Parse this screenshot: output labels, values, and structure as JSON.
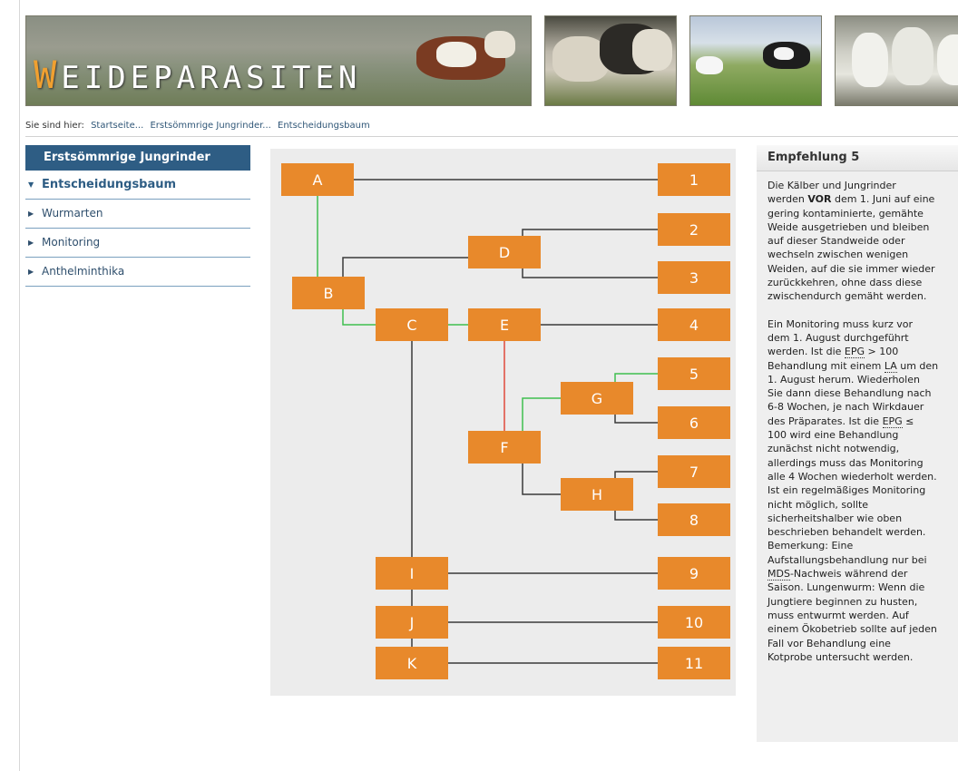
{
  "site": {
    "logo_initial": "W",
    "logo_rest": "EIDEPARASITEN",
    "images": [
      "Rind auf Weide",
      "Schafe",
      "Kühe mit Kalb",
      "Ziegen"
    ]
  },
  "breadcrumb": {
    "prefix": "Sie sind hier:",
    "items": [
      "Startseite...",
      "Erstsömmrige Jungrinder...",
      "Entscheidungsbaum"
    ]
  },
  "sidebar": {
    "title": "Erstsömmrige Jungrinder",
    "items": [
      {
        "label": "Entscheidungsbaum",
        "active": true,
        "caret": "▼"
      },
      {
        "label": "Wurmarten",
        "active": false,
        "caret": "▶"
      },
      {
        "label": "Monitoring",
        "active": false,
        "caret": "▶"
      },
      {
        "label": "Anthelminthika",
        "active": false,
        "caret": "▶"
      }
    ]
  },
  "diagram": {
    "colors": {
      "box": "#e8892b",
      "box_text": "#ffffff",
      "line_dark": "#3a3a3a",
      "line_green": "#3fbf4f",
      "line_red": "#e04a3c",
      "background": "#ececec"
    },
    "nodes": [
      "A",
      "B",
      "C",
      "D",
      "E",
      "F",
      "G",
      "H",
      "I",
      "J",
      "K"
    ],
    "outcomes": [
      "1",
      "2",
      "3",
      "4",
      "5",
      "6",
      "7",
      "8",
      "9",
      "10",
      "11"
    ]
  },
  "recommendation": {
    "title": "Empfehlung 5",
    "lines1": [
      "Die Kälber und Jungrinder",
      "werden |VOR| dem 1. Juni auf eine",
      "gering kontaminierte, gemähte",
      "Weide ausgetrieben und bleiben",
      "auf dieser Standweide oder",
      "wechseln zwischen wenigen",
      "Weiden, auf die sie immer wieder",
      "zurückkehren, ohne dass diese",
      "zwischendurch gemäht werden."
    ],
    "lines2": [
      "Ein Monitoring muss kurz vor",
      "dem 1. August durchgeführt",
      "werden. Ist die _EPG_ > 100",
      "Behandlung mit einem _LA_ um den",
      "1. August herum. Wiederholen",
      "Sie dann diese Behandlung nach",
      "6-8 Wochen, je nach Wirkdauer",
      "des Präparates. Ist die _EPG_ ≤",
      "100 wird eine Behandlung",
      "zunächst nicht notwendig,",
      "allerdings muss das Monitoring",
      "alle 4 Wochen wiederholt werden.",
      "Ist ein regelmäßiges Monitoring",
      "nicht möglich, sollte",
      "sicherheitshalber wie oben",
      "beschrieben behandelt werden.",
      "Bemerkung: Eine",
      "Aufstallungsbehandlung nur bei",
      "_MDS_-Nachweis während der",
      "Saison.  Lungenwurm: Wenn die",
      "Jungtiere beginnen zu husten,",
      "muss entwurmt werden. Auf",
      "einem Ökobetrieb sollte auf jeden",
      "Fall vor Behandlung eine",
      "Kotprobe untersucht werden."
    ]
  }
}
